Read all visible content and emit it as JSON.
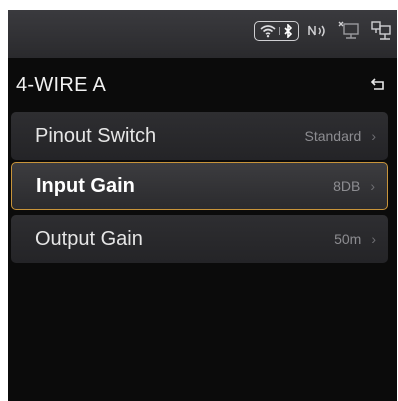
{
  "header": {
    "title": "4-WIRE A"
  },
  "menu": {
    "items": [
      {
        "label": "Pinout Switch",
        "value": "Standard",
        "selected": false
      },
      {
        "label": "Input Gain",
        "value": "8DB",
        "selected": true
      },
      {
        "label": "Output Gain",
        "value": "50m",
        "selected": false
      }
    ]
  },
  "status_icons": [
    "wifi-icon",
    "bluetooth-icon",
    "nfc-icon",
    "network-disconnected-icon",
    "network-icon"
  ],
  "colors": {
    "accent": "#c8943a",
    "background": "#0b0b0b",
    "row": "#2a2a2d"
  }
}
